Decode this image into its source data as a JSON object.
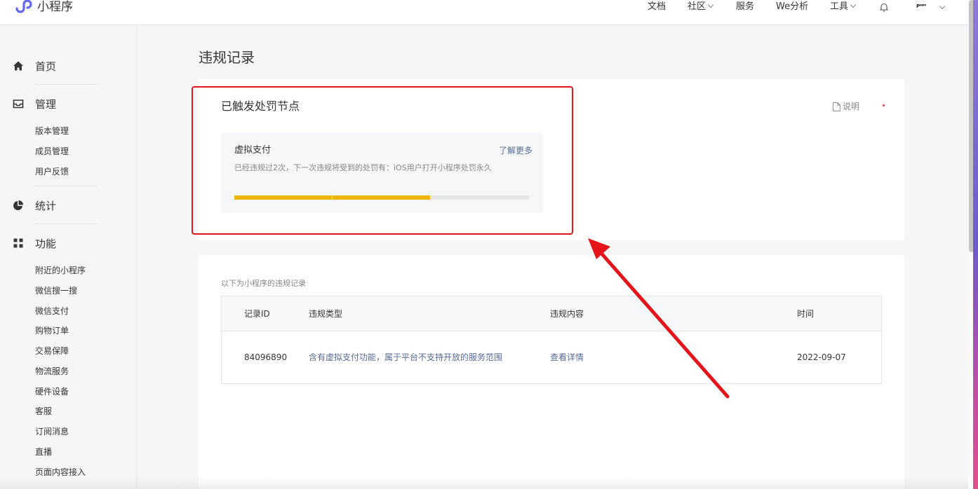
{
  "header": {
    "app_name": "小程序",
    "nav": [
      {
        "label": "文档",
        "dropdown": false
      },
      {
        "label": "社区",
        "dropdown": true
      },
      {
        "label": "服务",
        "dropdown": false
      },
      {
        "label": "We分析",
        "dropdown": false
      },
      {
        "label": "工具",
        "dropdown": true
      }
    ],
    "account_name": "Pᴬᴵᴵᴹ"
  },
  "sidebar": {
    "sections": [
      {
        "label": "首页",
        "icon": "home-icon",
        "items": []
      },
      {
        "label": "管理",
        "icon": "inbox-icon",
        "items": [
          "版本管理",
          "成员管理",
          "用户反馈"
        ]
      },
      {
        "label": "统计",
        "icon": "pie-chart-icon",
        "items": []
      },
      {
        "label": "功能",
        "icon": "grid-icon",
        "items": [
          "附近的小程序",
          "微信搜一搜",
          "微信支付",
          "购物订单",
          "交易保障",
          "物流服务",
          "硬件设备",
          "客服",
          "订阅消息",
          "直播",
          "页面内容接入"
        ]
      }
    ]
  },
  "main": {
    "title": "违规记录",
    "penalty_card": {
      "title": "已触发处罚节点",
      "explain_label": "说明",
      "node": {
        "title": "虚拟支付",
        "more_label": "了解更多",
        "description": "已经违规过2次，下一次违规将受到的处罚有：iOS用户打开小程序处罚永久",
        "progress": {
          "completed_segments": 2,
          "total_segments": 3
        }
      }
    },
    "records_card": {
      "note": "以下为小程序的违规记录",
      "columns": [
        "记录ID",
        "违规类型",
        "违规内容",
        "时间"
      ],
      "rows": [
        {
          "id": "84096890",
          "type": "含有虚拟支付功能，属于平台不支持开放的服务范围",
          "content": "查看详情",
          "time": "2022-09-07"
        }
      ]
    }
  },
  "colors": {
    "accent_link": "#576b95",
    "progress_fill": "#f0b400",
    "annotation_red": "#e5141b",
    "brand_purple": "#6467f0"
  }
}
